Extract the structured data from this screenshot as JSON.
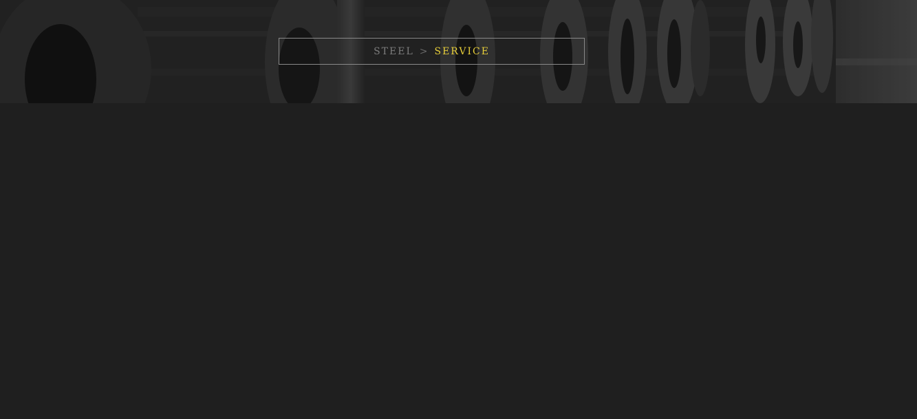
{
  "hero": {
    "background_icon": "steel-coils-photo",
    "breadcrumb": {
      "parent": "STEEL",
      "separator": ">",
      "current": "SERVICE"
    }
  },
  "colors": {
    "page_background": "#1f1f1f",
    "breadcrumb_border": "#8a8a8a",
    "breadcrumb_parent": "#7d7d7d",
    "breadcrumb_current": "#e8cf3a"
  }
}
